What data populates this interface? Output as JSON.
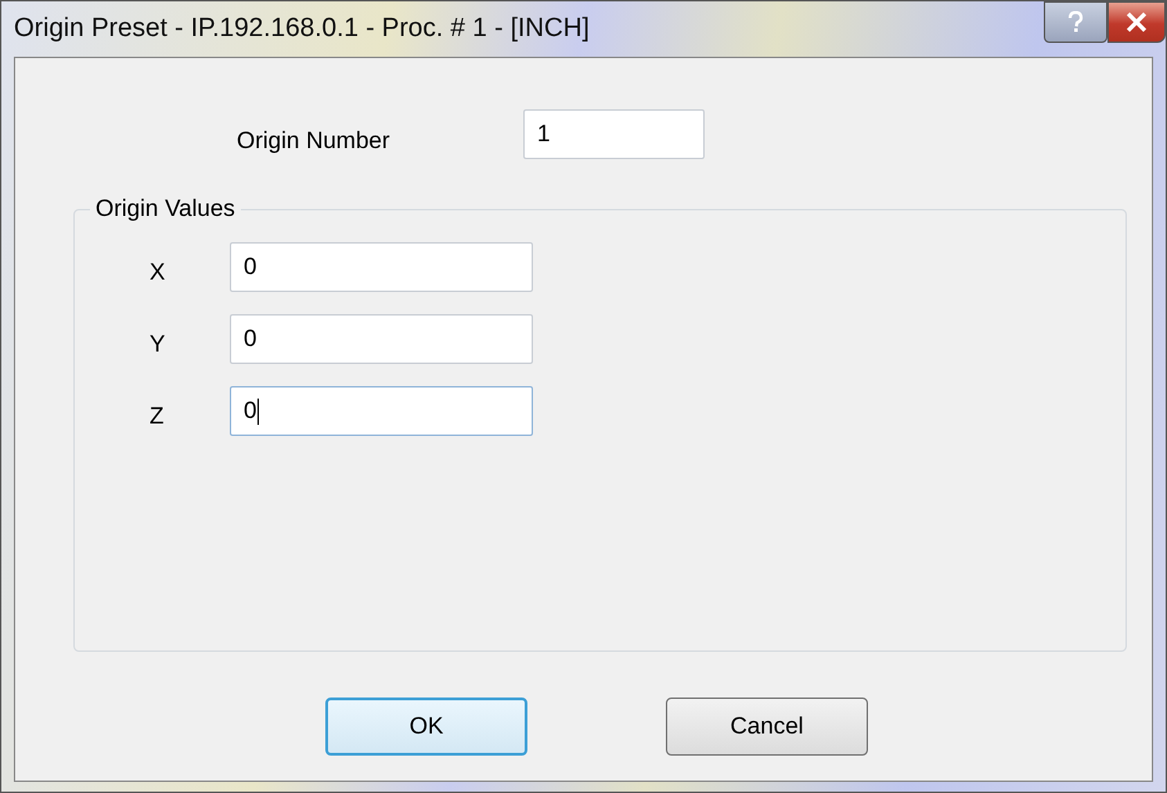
{
  "window": {
    "title": "Origin Preset - IP.192.168.0.1 - Proc. # 1 - [INCH]"
  },
  "origin_number": {
    "label": "Origin Number",
    "value": "1"
  },
  "origin_values": {
    "title": "Origin Values",
    "fields": [
      {
        "label": "X",
        "value": "0",
        "focused": false
      },
      {
        "label": "Y",
        "value": "0",
        "focused": false
      },
      {
        "label": "Z",
        "value": "0",
        "focused": true
      }
    ]
  },
  "buttons": [
    {
      "label": "OK",
      "default": true
    },
    {
      "label": "Cancel",
      "default": false
    }
  ]
}
